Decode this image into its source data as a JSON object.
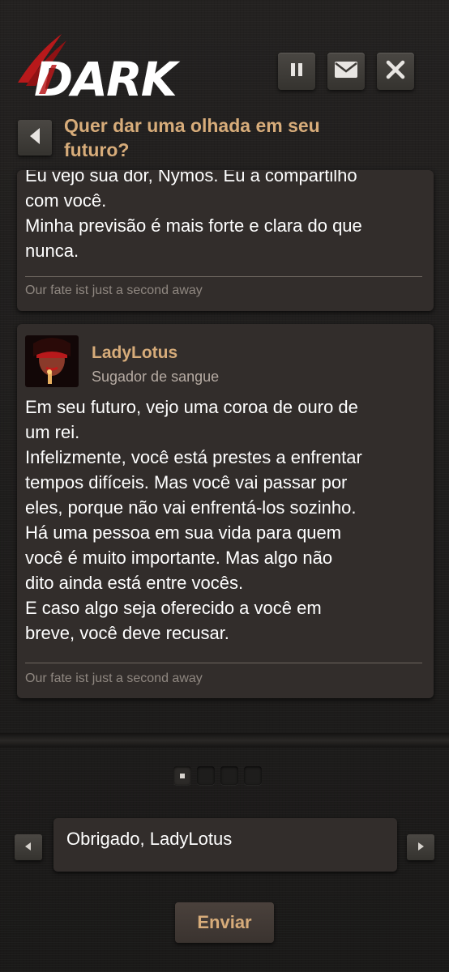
{
  "app": {
    "logo_text": "DARK"
  },
  "header": {
    "title": "Quer dar uma olhada em seu futuro?"
  },
  "posts": [
    {
      "message": "Eu vejo sua dor, Nymos. Eu a compartilho\ncom você.\nMinha previsão é mais forte e clara do que\nnunca.",
      "signature": "Our fate ist just a second away"
    },
    {
      "username": "LadyLotus",
      "role": "Sugador de sangue",
      "message": "Em seu futuro, vejo uma coroa de ouro de\num rei.\nInfelizmente, você está prestes a enfrentar\ntempos difíceis. Mas você vai passar por\neles, porque não vai enfrentá-los sozinho.\nHá uma pessoa em sua vida para quem\nvocê é muito importante. Mas algo não\ndito ainda está entre vocês.\nE caso algo seja oferecido a você em\nbreve, você deve recusar.",
      "signature": "Our fate ist just a second away"
    }
  ],
  "pager": {
    "pages": 4,
    "current": 1
  },
  "reply": {
    "value": "Obrigado, LadyLotus",
    "send_label": "Enviar"
  },
  "colors": {
    "accent": "#d7ac7a",
    "card": "#322d2b",
    "background": "#1c1b1a",
    "logo_red": "#b8191b"
  },
  "icons": [
    "pause-icon",
    "mail-icon",
    "close-icon",
    "chevron-left-icon",
    "chevron-right-icon"
  ]
}
